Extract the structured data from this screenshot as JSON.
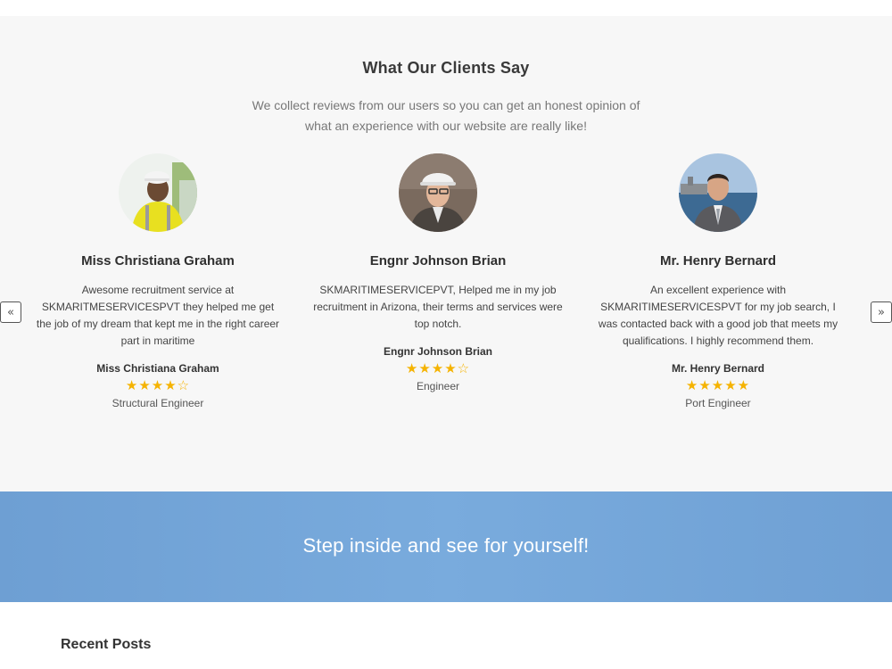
{
  "testimonials": {
    "title": "What Our Clients Say",
    "subtitle": "We collect reviews from our users so you can get an honest opinion of what an experience with our website are really like!",
    "prev_label": "«",
    "next_label": "»",
    "items": [
      {
        "name": "Miss Christiana Graham",
        "quote": "Awesome recruitment service at SKMARITMESERVICESPVT  they helped me get the job of my dream that kept me in  the right career part in maritime",
        "author": "Miss Christiana Graham",
        "rating": 4,
        "max_rating": 5,
        "stars_text": "★★★★☆",
        "role": "Structural Engineer"
      },
      {
        "name": "Engnr Johnson Brian",
        "quote": "SKMARITIMESERVICEPVT, Helped me  in my job recruitment in Arizona, their terms and services were top notch.",
        "author": "Engnr Johnson Brian",
        "rating": 4,
        "max_rating": 5,
        "stars_text": "★★★★☆",
        "role": "Engineer"
      },
      {
        "name": "Mr. Henry Bernard",
        "quote": "An excellent experience with SKMARITIMESERVICESPVT for my job search, I was contacted back with a good job that meets my qualifications. I highly recommend them.",
        "author": "Mr. Henry Bernard",
        "rating": 5,
        "max_rating": 5,
        "stars_text": "★★★★★",
        "role": "Port Engineer"
      }
    ]
  },
  "cta": {
    "text": "Step inside and see for yourself!"
  },
  "recent_posts": {
    "title": "Recent Posts"
  },
  "colors": {
    "section_bg": "#f7f7f7",
    "star": "#f5b301",
    "cta_bg": "#75a6da"
  }
}
